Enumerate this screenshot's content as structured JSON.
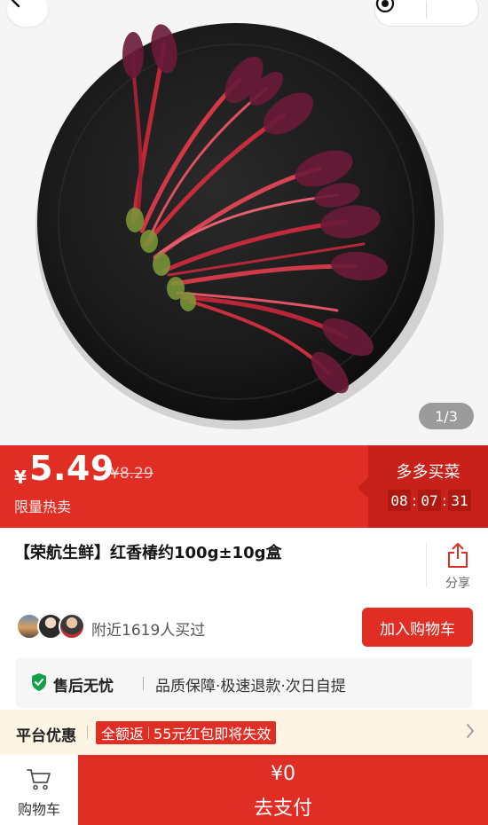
{
  "gallery": {
    "pager": "1/3"
  },
  "price": {
    "currency": "¥",
    "current": "5.49",
    "original": "¥8.29",
    "tag": "限量热卖"
  },
  "promo": {
    "title": "多多买菜",
    "countdown": {
      "h": "08",
      "m": "07",
      "s": "31"
    }
  },
  "product": {
    "title": "【荣航生鲜】红香椿约100g±10g盒",
    "share_label": "分享"
  },
  "buyers": {
    "text": "附近1619人买过",
    "add_cart_label": "加入购物车"
  },
  "guarantee": {
    "title": "售后无忧",
    "text": "品质保障·极速退款·次日自提"
  },
  "platform": {
    "title": "平台优惠",
    "tag_left": "全额返",
    "tag_right": "55元红包即将失效"
  },
  "bottom": {
    "cart_label": "购物车",
    "pay_amount": "¥0",
    "pay_label": "去支付"
  },
  "colors": {
    "accent": "#e02e24",
    "accent_dark": "#c8211a",
    "green": "#15a04a",
    "offer_bg": "#fdf4e3"
  }
}
